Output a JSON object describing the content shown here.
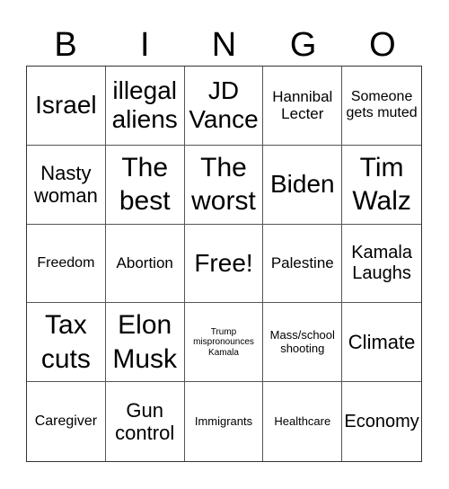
{
  "header": [
    "B",
    "I",
    "N",
    "G",
    "O"
  ],
  "cells": [
    "Israel",
    "illegal aliens",
    "JD Vance",
    "Hannibal Lecter",
    "Someone gets muted",
    "Nasty woman",
    "The best",
    "The worst",
    "Biden",
    "Tim Walz",
    "Freedom",
    "Abortion",
    "Free!",
    "Palestine",
    "Kamala Laughs",
    "Tax cuts",
    "Elon Musk",
    "Trump mispronounces Kamala",
    "Mass/school shooting",
    "Climate",
    "Caregiver",
    "Gun control",
    "Immigrants",
    "Healthcare",
    "Economy"
  ]
}
